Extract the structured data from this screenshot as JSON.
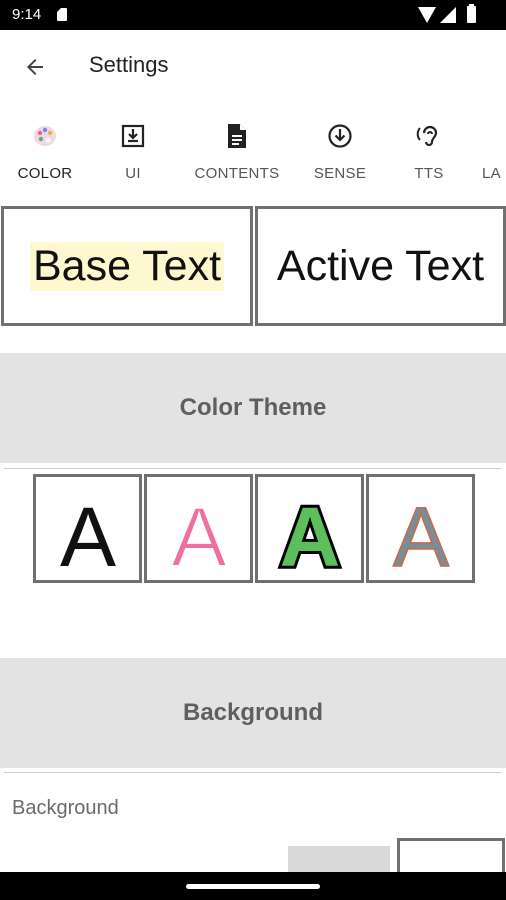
{
  "status_bar": {
    "time": "9:14"
  },
  "app_bar": {
    "title": "Settings"
  },
  "tabs": [
    {
      "label": "COLOR",
      "icon": "palette-icon",
      "active": true
    },
    {
      "label": "UI",
      "icon": "download-box-icon"
    },
    {
      "label": "CONTENTS",
      "icon": "document-icon"
    },
    {
      "label": "SENSE",
      "icon": "arrow-circle-down-icon"
    },
    {
      "label": "TTS",
      "icon": "ear-icon"
    },
    {
      "label": "LA",
      "icon": ""
    }
  ],
  "preview": {
    "base_text": "Base Text",
    "active_text": "Active Text"
  },
  "color_theme": {
    "title": "Color Theme",
    "letters": [
      {
        "letter": "A",
        "fill": "#111111",
        "stroke": "none"
      },
      {
        "letter": "A",
        "fill": "#ef6fa0",
        "stroke": "#ffffff"
      },
      {
        "letter": "A",
        "fill": "#5cbf5c",
        "stroke": "#000000"
      },
      {
        "letter": "A",
        "fill": "#7a8c96",
        "stroke": "#c96a4a"
      }
    ]
  },
  "background": {
    "title": "Background",
    "label": "Background"
  },
  "colors": {
    "accent": "#6ba9d6",
    "section_bg": "#e3e3e3",
    "base_highlight": "#fdf8cf"
  }
}
